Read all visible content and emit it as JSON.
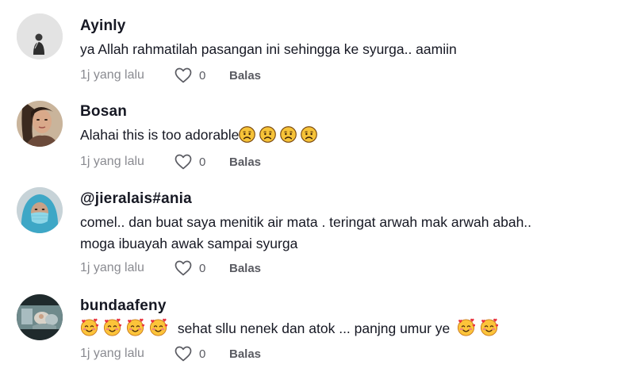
{
  "comments": [
    {
      "username": "Ayinly",
      "lines": [
        "ya Allah rahmatilah pasangan ini sehingga ke syurga.. aamiin"
      ],
      "time": "1j yang lalu",
      "likes": "0",
      "reply": "Balas"
    },
    {
      "username": "Bosan",
      "text": "Alahai this is too adorable",
      "emojis": [
        "sad-face-emoji",
        "sad-face-emoji",
        "sad-face-emoji",
        "sad-face-emoji"
      ],
      "time": "1j yang lalu",
      "likes": "0",
      "reply": "Balas"
    },
    {
      "username": "@jieralais#ania",
      "lines": [
        "comel.. dan buat saya menitik air mata . teringat arwah mak arwah abah..",
        "moga ibuayah awak sampai syurga"
      ],
      "time": "1j yang lalu",
      "likes": "0",
      "reply": "Balas"
    },
    {
      "username": "bundaafeny",
      "text": "sehat sllu nenek dan atok ... panjng umur ye",
      "emojis_before": [
        "smiling-face-hearts-emoji",
        "smiling-face-hearts-emoji",
        "smiling-face-hearts-emoji",
        "smiling-face-hearts-emoji"
      ],
      "emojis_after": [
        "smiling-face-hearts-emoji",
        "smiling-face-hearts-emoji"
      ],
      "time": "1j yang lalu",
      "likes": "0",
      "reply": "Balas"
    }
  ],
  "colors": {
    "text": "#161823",
    "meta": "#8a8b91",
    "action": "#5a5b62"
  }
}
